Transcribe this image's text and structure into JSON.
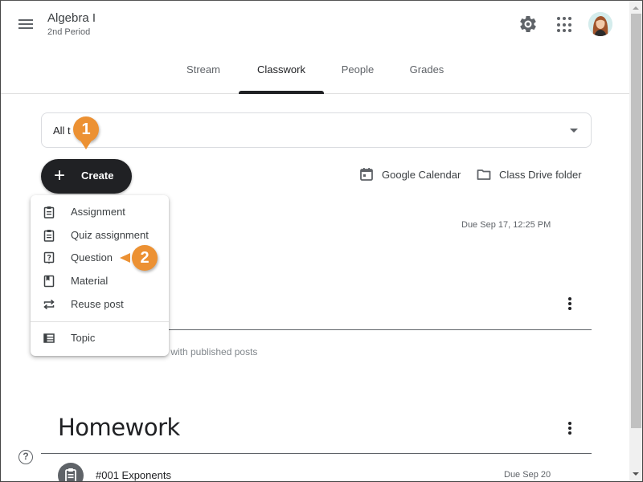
{
  "header": {
    "class_title": "Algebra I",
    "class_subtitle": "2nd Period",
    "icons": {
      "menu": "hamburger-icon",
      "settings": "gear-icon",
      "apps": "apps-grid-icon",
      "account": "avatar"
    }
  },
  "tabs": [
    {
      "label": "Stream",
      "active": false
    },
    {
      "label": "Classwork",
      "active": true
    },
    {
      "label": "People",
      "active": false
    },
    {
      "label": "Grades",
      "active": false
    }
  ],
  "topic_filter": {
    "value_visible": "All t"
  },
  "create_button": {
    "label": "Create",
    "icon": "plus-icon"
  },
  "links": {
    "calendar": {
      "label": "Google Calendar",
      "icon": "calendar-icon"
    },
    "drive": {
      "label": "Class Drive folder",
      "icon": "folder-icon"
    }
  },
  "create_menu": {
    "items": [
      {
        "label": "Assignment",
        "icon": "assignment-icon"
      },
      {
        "label": "Quiz assignment",
        "icon": "quiz-assignment-icon"
      },
      {
        "label": "Question",
        "icon": "question-icon"
      },
      {
        "label": "Material",
        "icon": "material-icon"
      },
      {
        "label": "Reuse post",
        "icon": "reuse-icon"
      }
    ],
    "topic": {
      "label": "Topic",
      "icon": "topic-icon"
    }
  },
  "stream": {
    "first_item_due": "Due Sep 17, 12:25 PM",
    "hint_partial": "cs with published posts",
    "section_title": "Homework",
    "section_items": [
      {
        "title": "#001 Exponents",
        "due": "Due Sep 20",
        "icon": "assignment-icon"
      }
    ]
  },
  "callouts": [
    {
      "number": "1",
      "target": "create-button"
    },
    {
      "number": "2",
      "target": "menu-item-question"
    }
  ],
  "colors": {
    "callout": "#ec9133",
    "create_button_bg": "#202124",
    "active_tab": "#202124",
    "muted_text": "#5f6368"
  }
}
